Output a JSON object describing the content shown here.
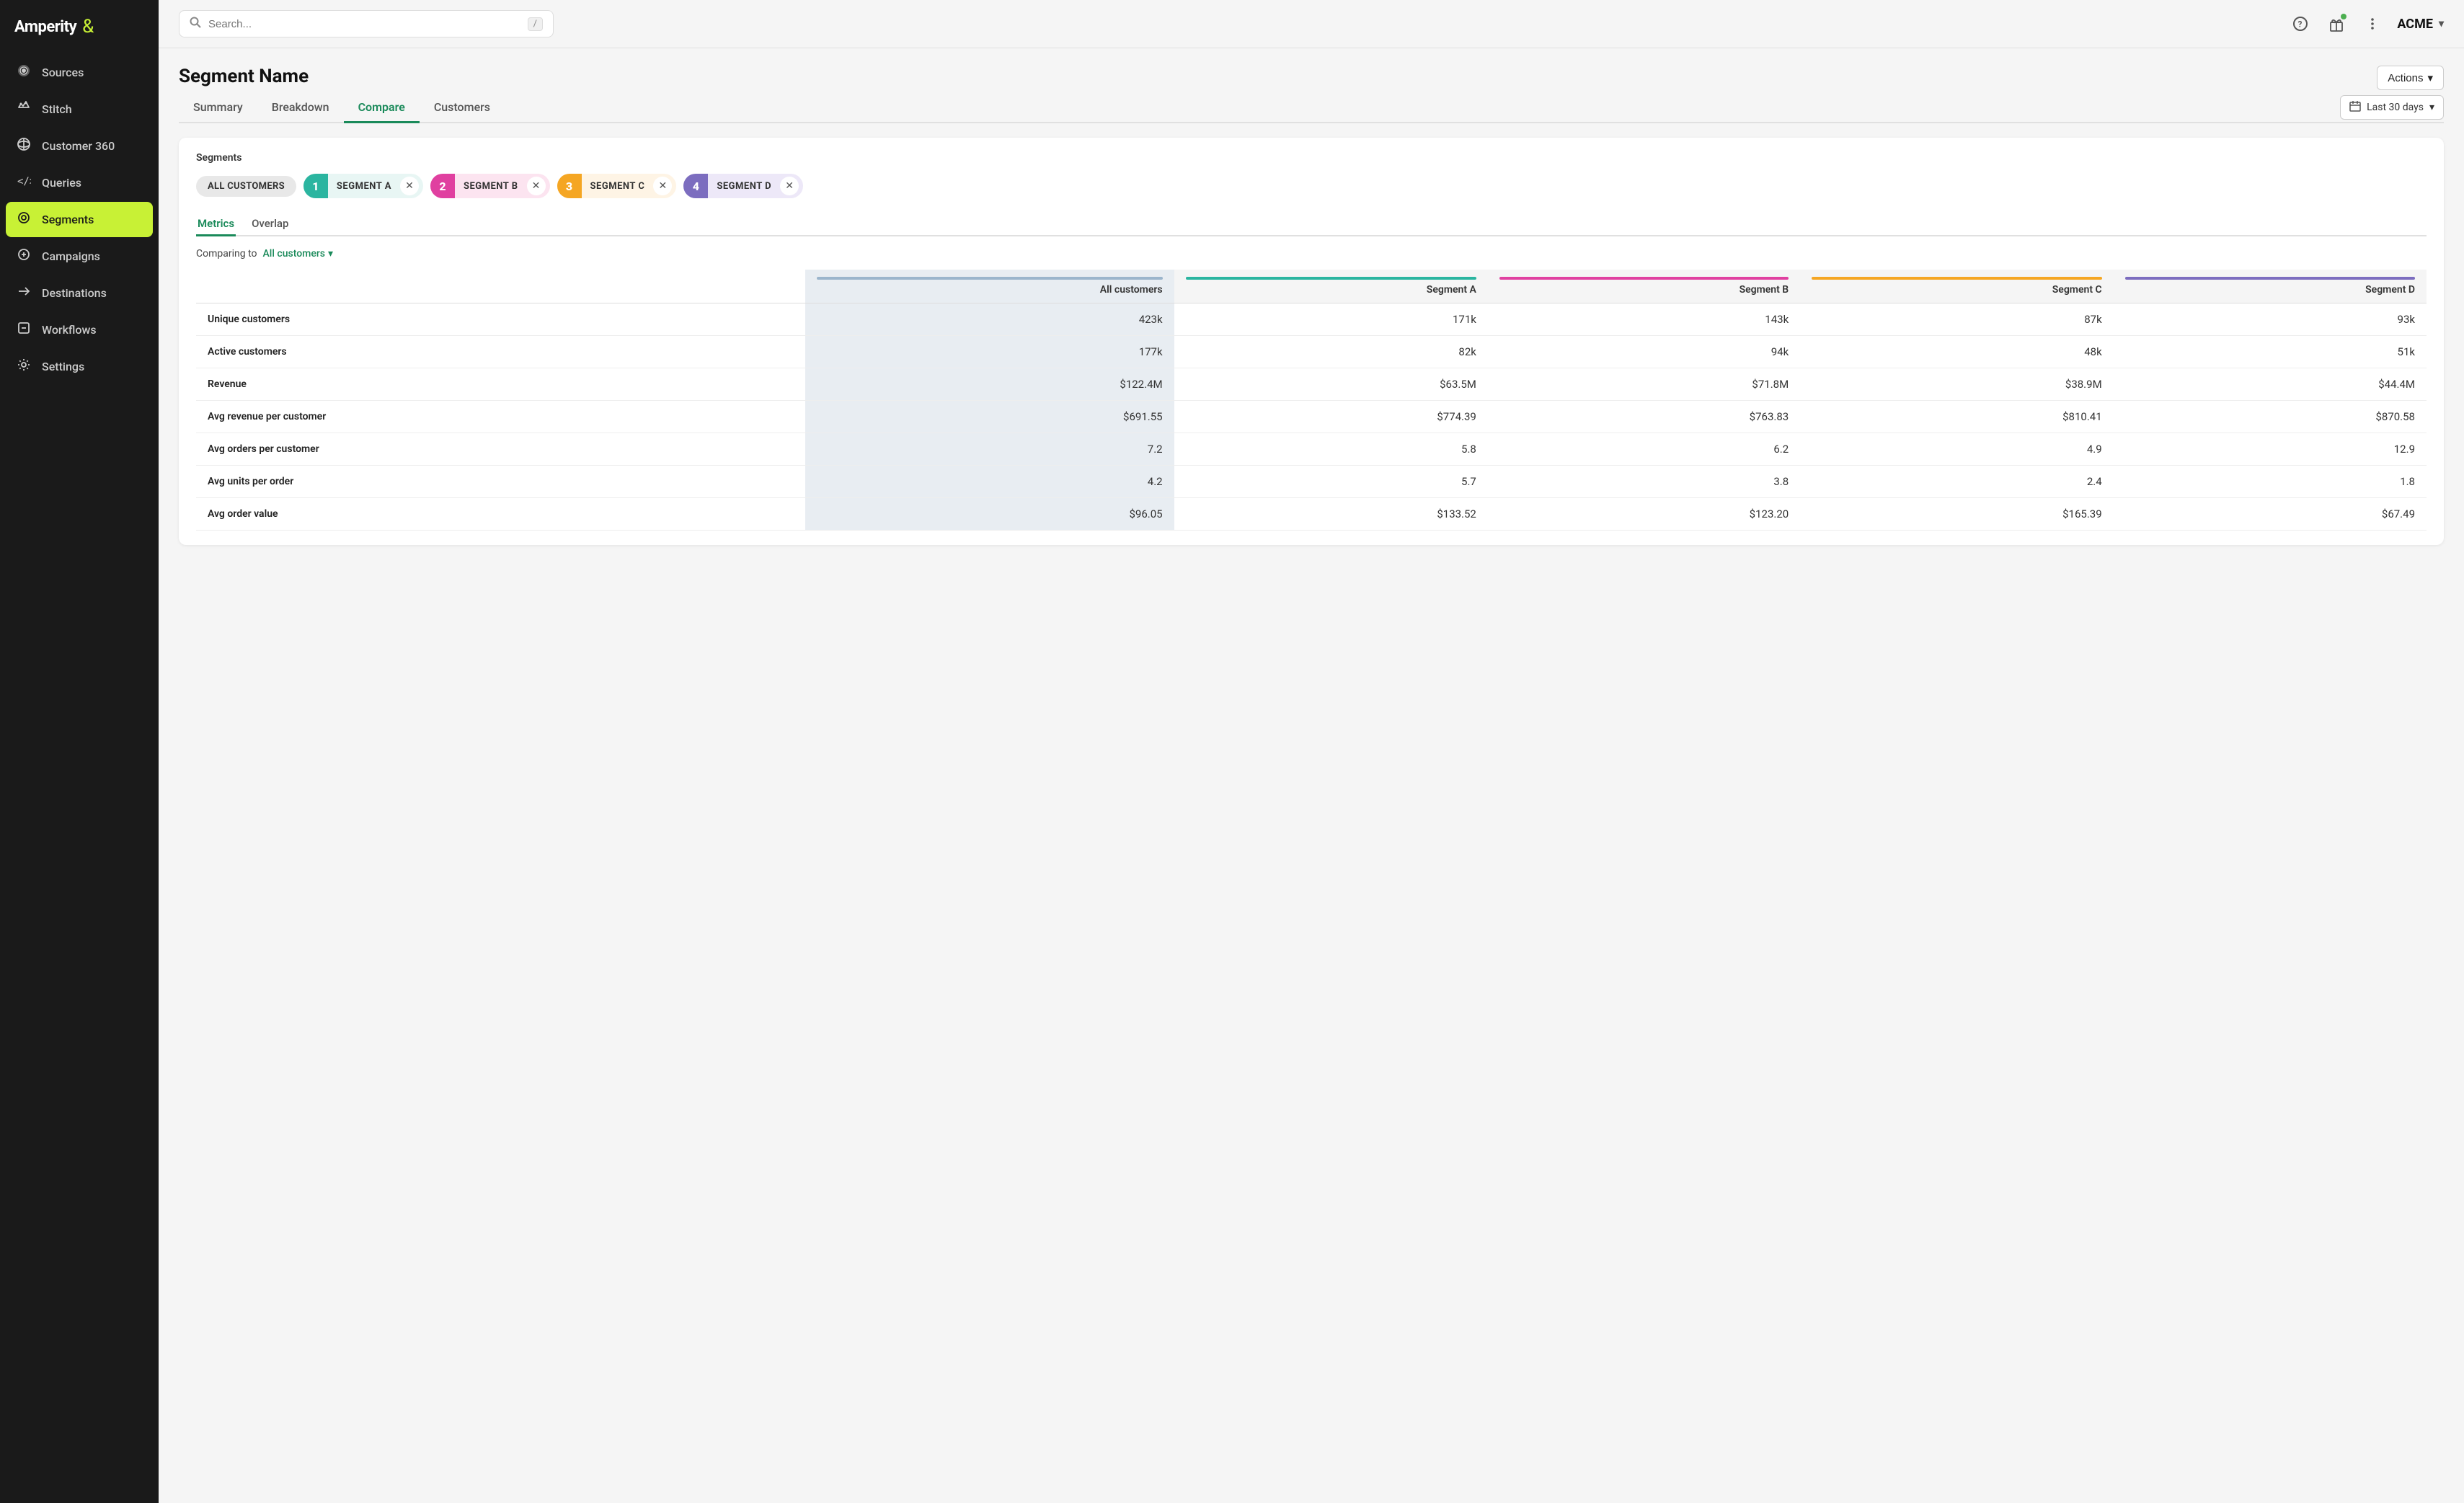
{
  "sidebar": {
    "logo": "Amperity",
    "logo_symbol": "&",
    "nav_items": [
      {
        "id": "sources",
        "label": "Sources",
        "icon": "⚙"
      },
      {
        "id": "stitch",
        "label": "Stitch",
        "icon": "✦"
      },
      {
        "id": "customer360",
        "label": "Customer 360",
        "icon": "◎"
      },
      {
        "id": "queries",
        "label": "Queries",
        "icon": "<>"
      },
      {
        "id": "segments",
        "label": "Segments",
        "icon": "⊙",
        "active": true
      },
      {
        "id": "campaigns",
        "label": "Campaigns",
        "icon": "◈"
      },
      {
        "id": "destinations",
        "label": "Destinations",
        "icon": "→"
      },
      {
        "id": "workflows",
        "label": "Workflows",
        "icon": "⊟"
      },
      {
        "id": "settings",
        "label": "Settings",
        "icon": "⚙"
      }
    ]
  },
  "topbar": {
    "search_placeholder": "/",
    "account": "ACME",
    "help_icon": "?",
    "gift_icon": "🎁",
    "more_icon": "⋮"
  },
  "page": {
    "title": "Segment Name",
    "actions_label": "Actions",
    "tabs": [
      {
        "id": "summary",
        "label": "Summary",
        "active": false
      },
      {
        "id": "breakdown",
        "label": "Breakdown",
        "active": false
      },
      {
        "id": "compare",
        "label": "Compare",
        "active": true
      },
      {
        "id": "customers",
        "label": "Customers",
        "active": false
      }
    ],
    "date_filter": "Last 30 days"
  },
  "compare": {
    "segments_label": "Segments",
    "all_customers_chip": "ALL CUSTOMERS",
    "segments": [
      {
        "id": "a",
        "num": "1",
        "label": "SEGMENT A",
        "color_class": "chip-a"
      },
      {
        "id": "b",
        "num": "2",
        "label": "SEGMENT B",
        "color_class": "chip-b"
      },
      {
        "id": "c",
        "num": "3",
        "label": "SEGMENT C",
        "color_class": "chip-c"
      },
      {
        "id": "d",
        "num": "4",
        "label": "SEGMENT D",
        "color_class": "chip-d"
      }
    ],
    "inner_tabs": [
      {
        "id": "metrics",
        "label": "Metrics",
        "active": true
      },
      {
        "id": "overlap",
        "label": "Overlap",
        "active": false
      }
    ],
    "comparing_to_label": "Comparing to",
    "comparing_to_value": "All customers",
    "columns": [
      {
        "id": "all",
        "label": "All customers",
        "bar_color": "#9bb5cc"
      },
      {
        "id": "seg_a",
        "label": "Segment A",
        "bar_color": "#2bb5a0"
      },
      {
        "id": "seg_b",
        "label": "Segment B",
        "bar_color": "#e040a0"
      },
      {
        "id": "seg_c",
        "label": "Segment C",
        "bar_color": "#f5a623"
      },
      {
        "id": "seg_d",
        "label": "Segment D",
        "bar_color": "#7c6dbf"
      }
    ],
    "metrics": [
      {
        "id": "unique_customers",
        "label": "Unique customers",
        "all": "423k",
        "seg_a": "171k",
        "seg_b": "143k",
        "seg_c": "87k",
        "seg_d": "93k"
      },
      {
        "id": "active_customers",
        "label": "Active customers",
        "all": "177k",
        "seg_a": "82k",
        "seg_b": "94k",
        "seg_c": "48k",
        "seg_d": "51k"
      },
      {
        "id": "revenue",
        "label": "Revenue",
        "all": "$122.4M",
        "seg_a": "$63.5M",
        "seg_b": "$71.8M",
        "seg_c": "$38.9M",
        "seg_d": "$44.4M"
      },
      {
        "id": "avg_revenue_per_customer",
        "label": "Avg revenue per customer",
        "all": "$691.55",
        "seg_a": "$774.39",
        "seg_b": "$763.83",
        "seg_c": "$810.41",
        "seg_d": "$870.58"
      },
      {
        "id": "avg_orders_per_customer",
        "label": "Avg orders per customer",
        "all": "7.2",
        "seg_a": "5.8",
        "seg_b": "6.2",
        "seg_c": "4.9",
        "seg_d": "12.9"
      },
      {
        "id": "avg_units_per_order",
        "label": "Avg units per order",
        "all": "4.2",
        "seg_a": "5.7",
        "seg_b": "3.8",
        "seg_c": "2.4",
        "seg_d": "1.8"
      },
      {
        "id": "avg_order_value",
        "label": "Avg order value",
        "all": "$96.05",
        "seg_a": "$133.52",
        "seg_b": "$123.20",
        "seg_c": "$165.39",
        "seg_d": "$67.49"
      }
    ]
  }
}
